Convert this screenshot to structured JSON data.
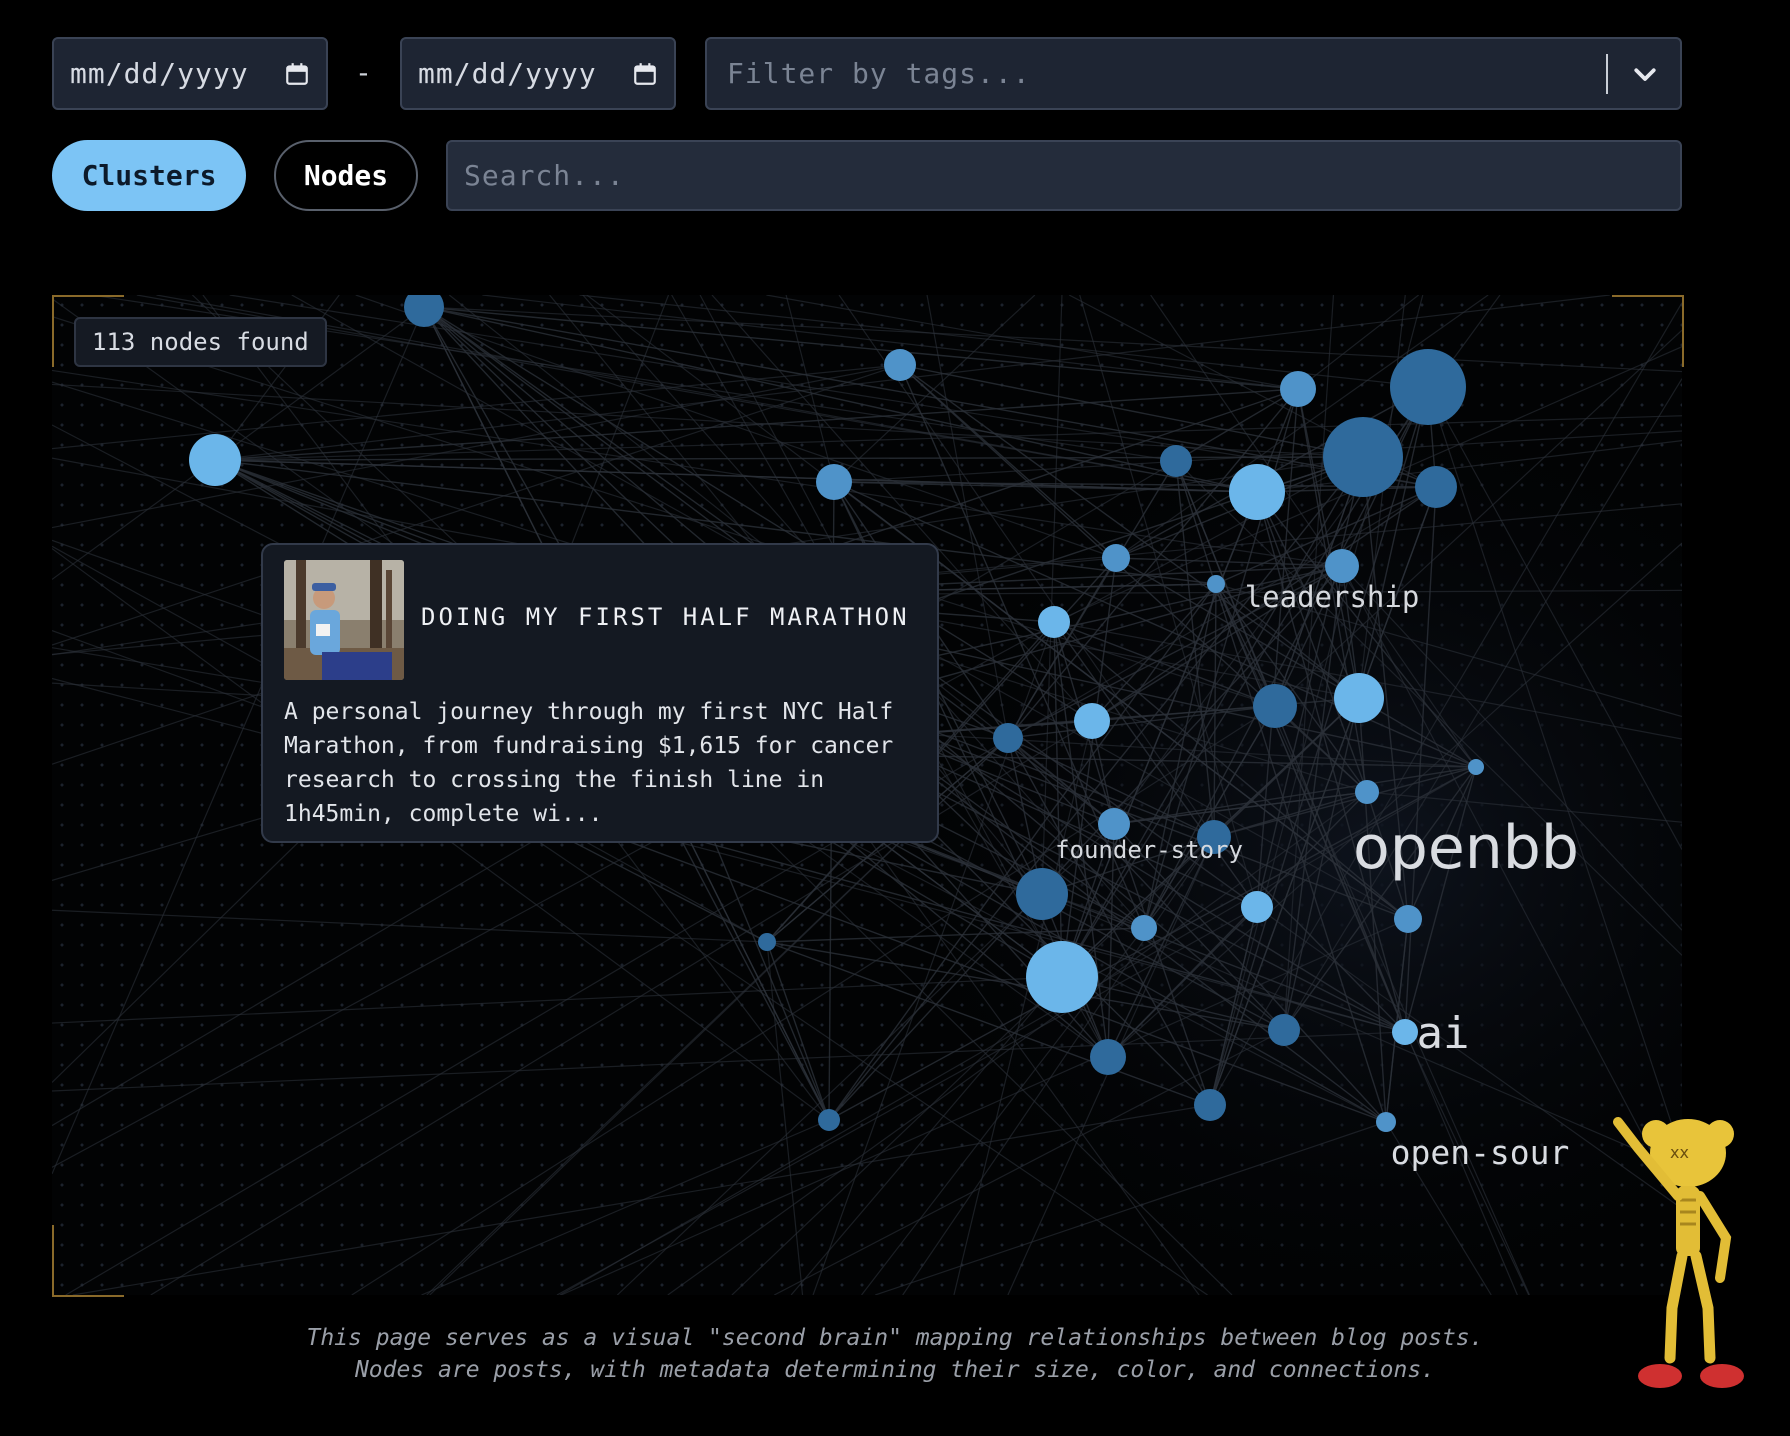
{
  "filters": {
    "date_start_placeholder": "mm/dd/yyyy",
    "date_separator": "-",
    "date_end_placeholder": "mm/dd/yyyy",
    "tags_placeholder": "Filter by tags...",
    "calendar_icon": "calendar-icon",
    "dropdown_icon": "chevron-down-icon"
  },
  "view_toggle": {
    "clusters_label": "Clusters",
    "nodes_label": "Nodes",
    "active": "Clusters"
  },
  "search": {
    "placeholder": "Search..."
  },
  "graph": {
    "node_count_label": "113 nodes found",
    "cluster_labels": [
      "leadership",
      "founder-story",
      "openbb",
      "ai",
      "open-sour"
    ],
    "colors": {
      "light_node": "#6bb6ea",
      "dark_node": "#2f6a9c",
      "edge": "#2b3038",
      "accent_corner": "#8a6a2a"
    }
  },
  "tooltip": {
    "title": "DOING MY FIRST HALF MARATHON",
    "description": "A personal journey through my first NYC Half\nMarathon, from fundraising $1,615 for cancer\nresearch to crossing the finish line in\n1h45min, complete wi..."
  },
  "footer": {
    "line1": "This page serves as a visual \"second brain\" mapping relationships between blog posts.",
    "line2": "Nodes are posts, with metadata determining their size, color, and connections."
  }
}
